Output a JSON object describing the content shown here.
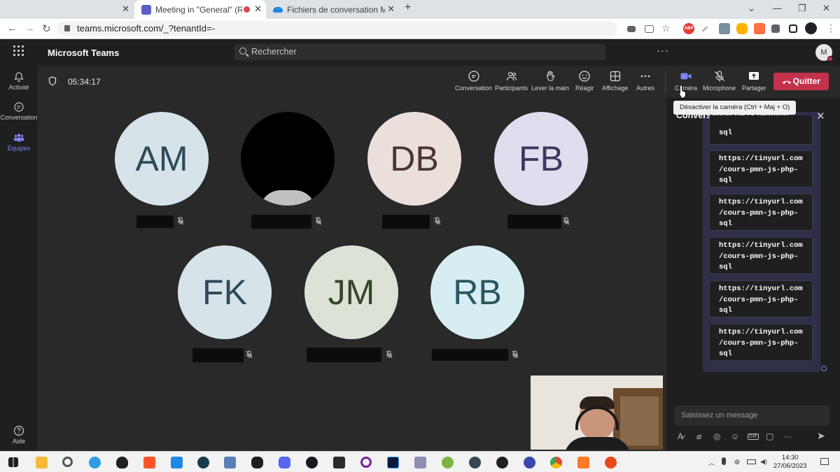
{
  "browser": {
    "tabs": [
      {
        "title": "Meeting in \"General\" (Réunio",
        "active": true
      },
      {
        "title": "Fichiers de conversation Microso",
        "active": false
      }
    ],
    "url": "teams.microsoft.com/_?tenantId=-"
  },
  "teams": {
    "app_title": "Microsoft Teams",
    "search_placeholder": "Rechercher",
    "more": "···",
    "me_initial": "M"
  },
  "rail": [
    {
      "label": "Activité",
      "icon": "bell-icon",
      "selected": false
    },
    {
      "label": "Conversation",
      "icon": "chat-icon",
      "selected": false
    },
    {
      "label": "Équipes",
      "icon": "teams-icon",
      "selected": true
    },
    {
      "label": "Aide",
      "icon": "help-icon",
      "selected": false
    }
  ],
  "meeting": {
    "timer": "05:34:17",
    "toolbar": {
      "conversation": "Conversation",
      "participants": "Participants",
      "raise_hand": "Lever la main",
      "react": "Réagir",
      "view": "Affichage",
      "more": "Autres",
      "camera": "Caméra",
      "microphone": "Microphone",
      "share": "Partager",
      "leave": "Quitter"
    },
    "tooltip": "Désactiver la caméra (Ctrl + Maj + O)",
    "participants": [
      {
        "initials": "AM",
        "bg": "#d6e4ea",
        "fg": "#2d4a57"
      },
      {
        "initials": "",
        "bg": "#000000",
        "fg": "#ffffff"
      },
      {
        "initials": "DB",
        "bg": "#eadfdb",
        "fg": "#4a3630"
      },
      {
        "initials": "FB",
        "bg": "#e2ddee",
        "fg": "#3f3660"
      },
      {
        "initials": "FK",
        "bg": "#d6e4ea",
        "fg": "#2d4a57"
      },
      {
        "initials": "JM",
        "bg": "#dde2d6",
        "fg": "#35442b"
      },
      {
        "initials": "RB",
        "bg": "#d6eef2",
        "fg": "#2a5760"
      }
    ]
  },
  "chat": {
    "title": "Conversation de la réunion",
    "partial_top": "sql",
    "messages": [
      "https://tinyurl.com\n/cours-pmn-js-php-\nsql",
      "https://tinyurl.com\n/cours-pmn-js-php-\nsql",
      "https://tinyurl.com\n/cours-pmn-js-php-\nsql",
      "https://tinyurl.com\n/cours-pmn-js-php-\nsql",
      "https://tinyurl.com\n/cours-pmn-js-php-\nsql"
    ],
    "compose_placeholder": "Saisissez un message"
  },
  "taskbar": {
    "time": "14:30",
    "date": "27/06/2023"
  },
  "colors": {
    "accent": "#7f85f5",
    "leave": "#c4314b"
  }
}
